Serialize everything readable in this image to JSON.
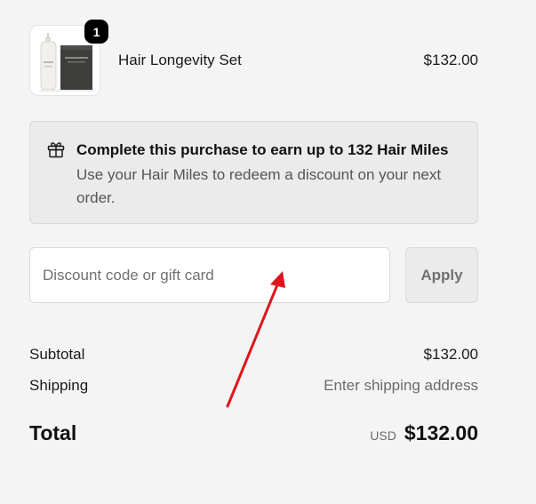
{
  "line_item": {
    "quantity": "1",
    "name": "Hair Longevity Set",
    "price": "$132.00",
    "thumbnail_icon": "product-image"
  },
  "miles": {
    "icon": "gift-icon",
    "title": "Complete this purchase to earn up to 132 Hair Miles",
    "description": "Use your Hair Miles to redeem a discount on your next order."
  },
  "discount": {
    "placeholder": "Discount code or gift card",
    "value": "",
    "apply_label": "Apply"
  },
  "summary": {
    "subtotal_label": "Subtotal",
    "subtotal_value": "$132.00",
    "shipping_label": "Shipping",
    "shipping_value": "Enter shipping address",
    "total_label": "Total",
    "currency": "USD",
    "total_value": "$132.00"
  },
  "annotation": {
    "type": "arrow",
    "color": "#e0141e"
  },
  "colors": {
    "background": "#f4f4f4",
    "text": "#1a1a1a",
    "muted": "#6b6b6b",
    "badge": "#000000"
  }
}
